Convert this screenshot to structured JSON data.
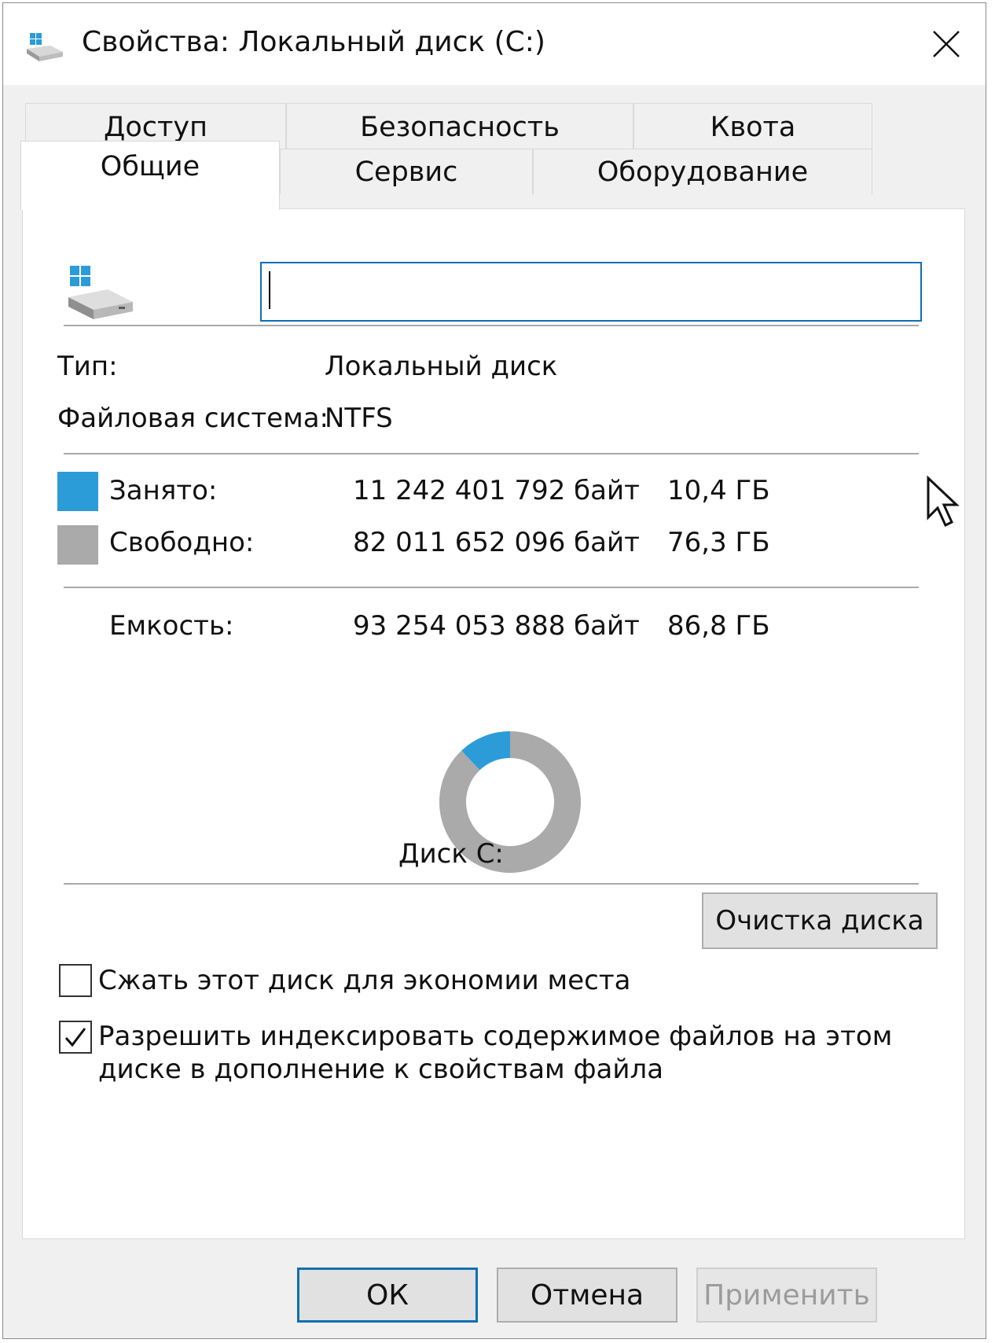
{
  "window": {
    "title": "Свойства: Локальный диск (C:)",
    "icons": {
      "title": "drive-icon",
      "close": "close-icon"
    }
  },
  "tabs": {
    "row_back": [
      {
        "label": "Доступ"
      },
      {
        "label": "Безопасность"
      },
      {
        "label": "Квота"
      }
    ],
    "row_front": [
      {
        "label": "Общие",
        "active": true
      },
      {
        "label": "Сервис"
      },
      {
        "label": "Оборудование"
      }
    ]
  },
  "general": {
    "name_input": {
      "value": "",
      "placeholder": ""
    },
    "type": {
      "label": "Тип:",
      "value": "Локальный диск"
    },
    "filesystem": {
      "label": "Файловая система:",
      "value": "NTFS"
    },
    "used": {
      "label": "Занято:",
      "bytes": "11 242 401 792 байт",
      "size": "10,4 ГБ",
      "color": "#2b9cd8"
    },
    "free": {
      "label": "Свободно:",
      "bytes": "82 011 652 096 байт",
      "size": "76,3 ГБ",
      "color": "#aaaaaa"
    },
    "capacity": {
      "label": "Емкость:",
      "bytes": "93 254 053 888 байт",
      "size": "86,8 ГБ"
    },
    "chart": {
      "used_fraction": 0.1206
    },
    "disk_label": "Диск C:",
    "cleanup_button": "Очистка диска",
    "compress": {
      "label": "Сжать этот диск для экономии места",
      "checked": false
    },
    "index": {
      "label_line1": "Разрешить индексировать содержимое файлов на этом",
      "label_line2": "диске в дополнение к свойствам файла",
      "checked": true
    }
  },
  "buttons": {
    "ok": "ОК",
    "cancel": "Отмена",
    "apply": "Применить"
  }
}
